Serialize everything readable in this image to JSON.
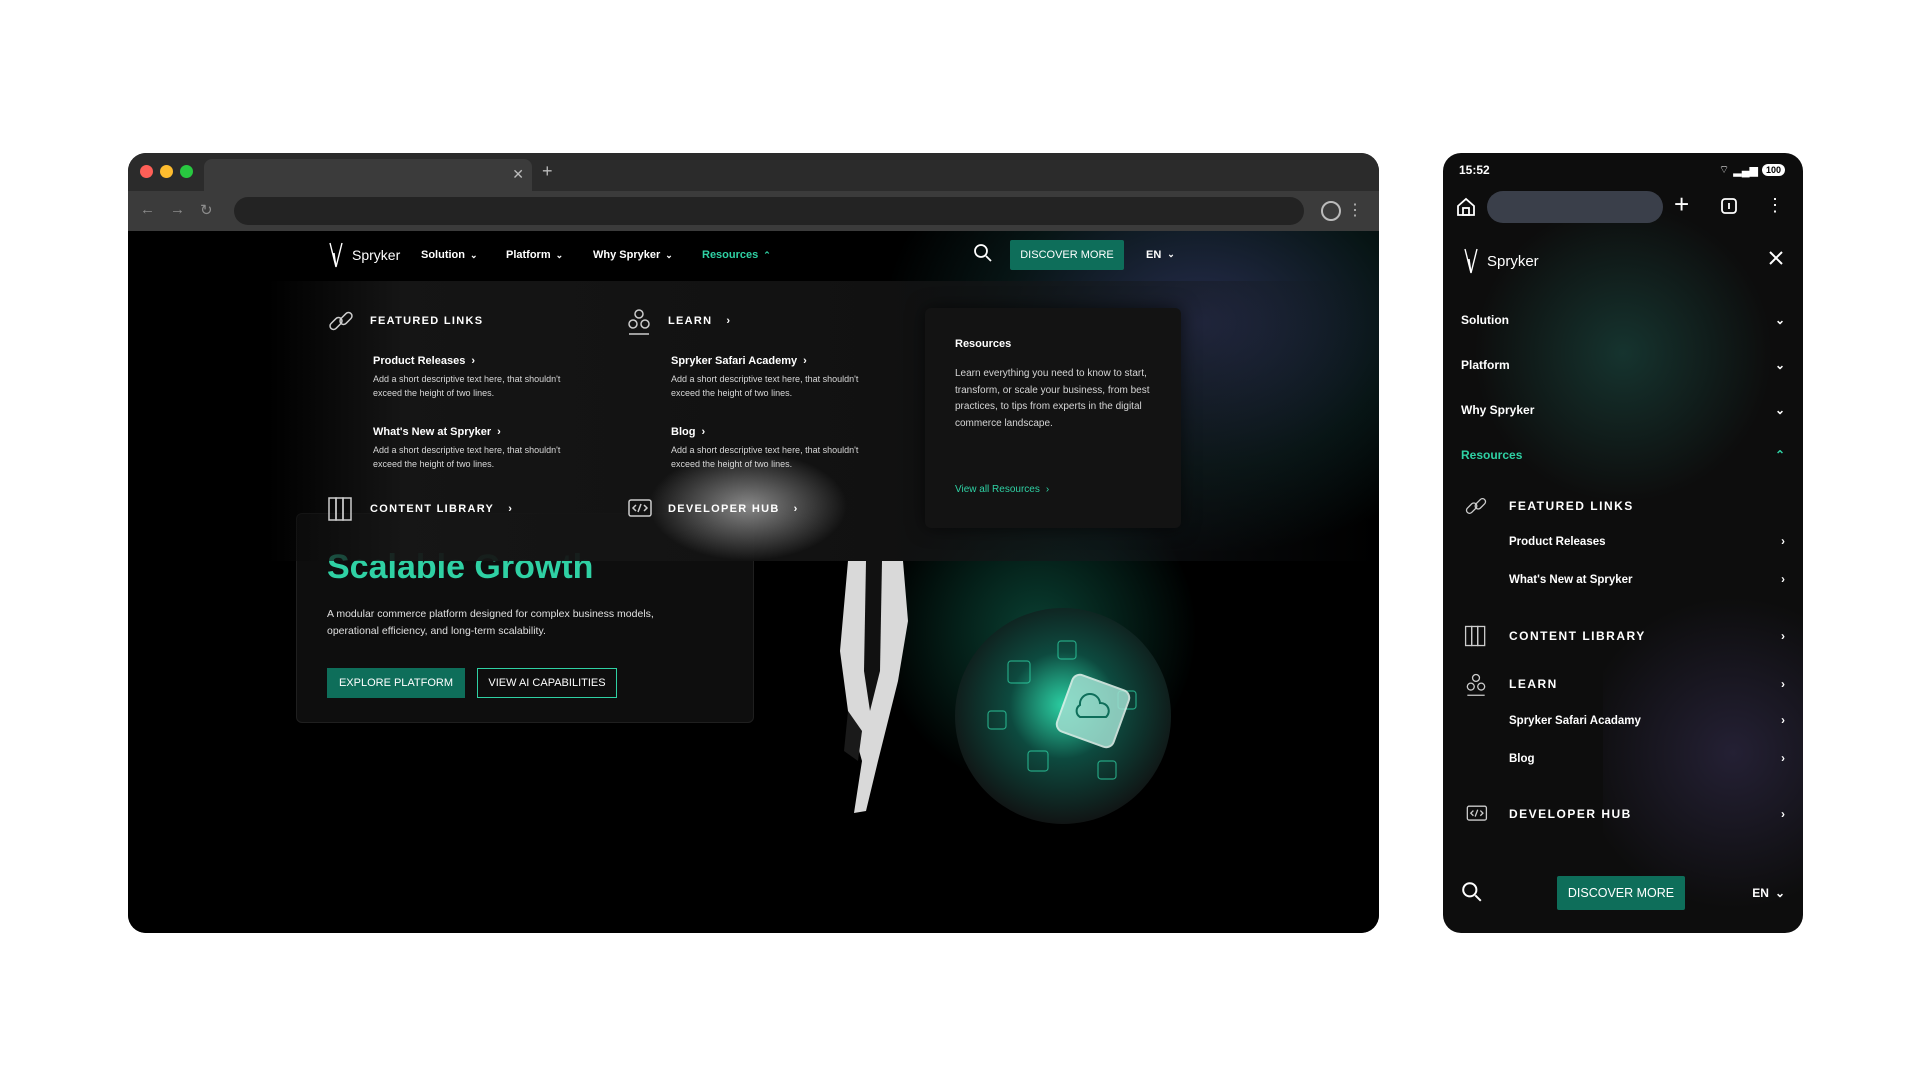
{
  "desktop": {
    "nav": {
      "logo": "Spryker",
      "items": [
        "Solution",
        "Platform",
        "Why Spryker",
        "Resources"
      ],
      "discover": "DISCOVER MORE",
      "lang": "EN"
    },
    "mega": {
      "featured": {
        "heading": "FEATURED LINKS",
        "links": [
          {
            "label": "Product Releases",
            "desc": "Add a short descriptive text here, that shouldn't exceed the height of two lines."
          },
          {
            "label": "What's New at Spryker",
            "desc": "Add a short descriptive text here, that shouldn't exceed the height of two lines."
          }
        ]
      },
      "learn": {
        "heading": "LEARN",
        "links": [
          {
            "label": "Spryker Safari Academy",
            "desc": "Add a short descriptive text here, that shouldn't exceed the height of two lines."
          },
          {
            "label": "Blog",
            "desc": "Add a short descriptive text here, that shouldn't exceed the height of two lines."
          }
        ]
      },
      "content_library": "CONTENT LIBRARY",
      "developer_hub": "DEVELOPER HUB",
      "card": {
        "title": "Resources",
        "text": "Learn everything you need to know to start, transform, or scale your business, from best practices, to tips from experts in the digital commerce landscape.",
        "link": "View all Resources"
      }
    },
    "hero": {
      "title": "Scalable Growth",
      "subtitle": "A modular commerce platform designed for complex business models, operational efficiency, and long-term scalability.",
      "primary": "EXPLORE PLATFORM",
      "secondary": "VIEW AI CAPABILITIES"
    }
  },
  "mobile": {
    "time": "15:52",
    "battery": "100",
    "logo": "Spryker",
    "menu": [
      "Solution",
      "Platform",
      "Why Spryker",
      "Resources"
    ],
    "featured": "FEATURED LINKS",
    "featured_links": [
      "Product Releases",
      "What's New at Spryker"
    ],
    "content_library": "CONTENT LIBRARY",
    "learn": "LEARN",
    "learn_links": [
      "Spryker Safari Acadamy",
      "Blog"
    ],
    "developer_hub": "DEVELOPER HUB",
    "discover": "DISCOVER MORE",
    "lang": "EN"
  },
  "colors": {
    "accent": "#2fd1a4",
    "button": "#0e6e5a"
  }
}
